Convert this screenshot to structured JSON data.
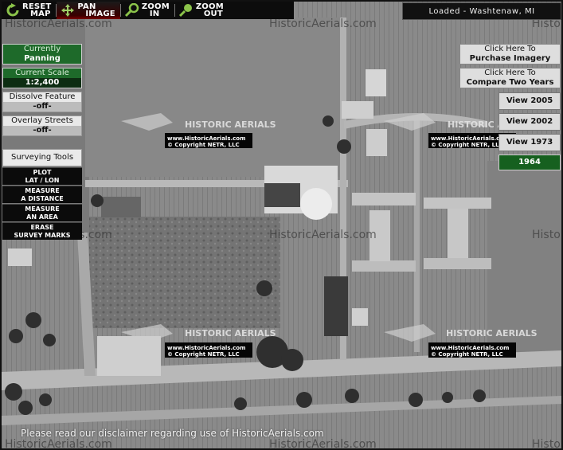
{
  "toolbar": {
    "reset": {
      "line1": "RESET",
      "line2": "MAP"
    },
    "pan": {
      "line1": "PAN",
      "line2": "IMAGE"
    },
    "zoom_in": {
      "line1": "ZOOM",
      "line2": "IN"
    },
    "zoom_out": {
      "line1": "ZOOM",
      "line2": "OUT"
    }
  },
  "status": "Loaded - Washtenaw, MI",
  "left_panel": {
    "mode": {
      "header": "Currently",
      "value": "Panning"
    },
    "scale": {
      "header": "Current Scale",
      "value": "1:2,400"
    },
    "dissolve": {
      "header": "Dissolve Feature",
      "value": "-off-"
    },
    "overlay": {
      "header": "Overlay Streets",
      "value": "-off-"
    },
    "surveying_title": "Surveying Tools",
    "tools": [
      {
        "line1": "PLOT",
        "line2": "LAT / LON"
      },
      {
        "line1": "MEASURE",
        "line2": "A DISTANCE"
      },
      {
        "line1": "MEASURE",
        "line2": "AN AREA"
      },
      {
        "line1": "ERASE",
        "line2": "SURVEY MARKS"
      }
    ]
  },
  "right_panel": {
    "purchase": {
      "line1": "Click Here To",
      "line2": "Purchase Imagery"
    },
    "compare": {
      "line1": "Click Here To",
      "line2": "Compare Two Years"
    },
    "years": [
      "View 2005",
      "View 2002",
      "View 1973"
    ],
    "current_year": "1964"
  },
  "map": {
    "watermark": "HistoricAerials.com",
    "edge_watermark": "Histo",
    "stamp_title": "HISTORIC AERIALS",
    "stamp_url": "www.HistoricAerials.com",
    "stamp_copyright": "© Copyright NETR, LLC"
  },
  "disclaimer": "Please read our disclaimer regarding use of HistoricAerials.com",
  "colors": {
    "accent_green": "#1e6a2a",
    "toolbar_bg": "#0c0c0c"
  }
}
